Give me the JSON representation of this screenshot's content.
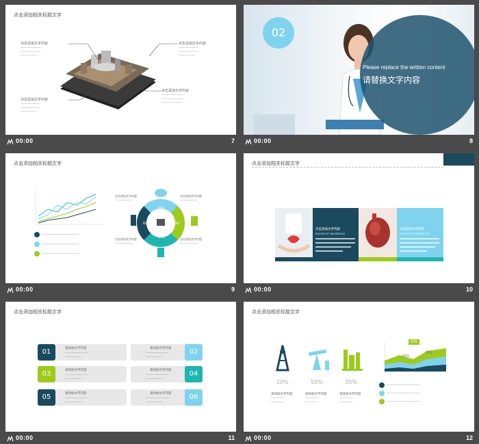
{
  "slide_title": "点击添加相关标题文字",
  "time_label": "00:00",
  "slides": [
    {
      "number": "7",
      "callouts": [
        "点击添加文字内容",
        "点击添加文字内容",
        "点击添加文字内容",
        "点击添加文字内容"
      ]
    },
    {
      "number": "8",
      "badge": "02",
      "english": "Please replace the written content",
      "chinese": "请替换文字内容"
    },
    {
      "number": "9",
      "callouts": [
        "点击添加文字内容",
        "点击添加文字内容",
        "点击添加文字内容",
        "点击添加文字内容"
      ],
      "donut_labels": [
        "70%",
        "30%",
        "40%",
        "60%"
      ]
    },
    {
      "number": "10",
      "panel_titles": [
        "点击添加文字内容",
        "点击添加文字内容"
      ],
      "panel_sub": "ELECTR OF THE ARTICLE"
    },
    {
      "number": "11",
      "boxes": [
        {
          "num": "01",
          "label": "请添加文字内容"
        },
        {
          "num": "02",
          "label": "请添加文字内容"
        },
        {
          "num": "03",
          "label": "请添加文字内容"
        },
        {
          "num": "04",
          "label": "请添加文字内容"
        },
        {
          "num": "05",
          "label": "请添加文字内容"
        },
        {
          "num": "06",
          "label": "请添加文字内容"
        }
      ]
    },
    {
      "number": "12",
      "percents": [
        "20%",
        "50%",
        "30%"
      ],
      "labels": [
        "请添加文字内容",
        "请添加文字内容",
        "请添加文字内容"
      ],
      "chart_bubbles": [
        "30%",
        "20%",
        "50%"
      ]
    }
  ],
  "colors": {
    "navy": "#1b4a5e",
    "teal": "#1fb5b0",
    "lime": "#9dcb1c",
    "sky": "#7fd3ee"
  }
}
